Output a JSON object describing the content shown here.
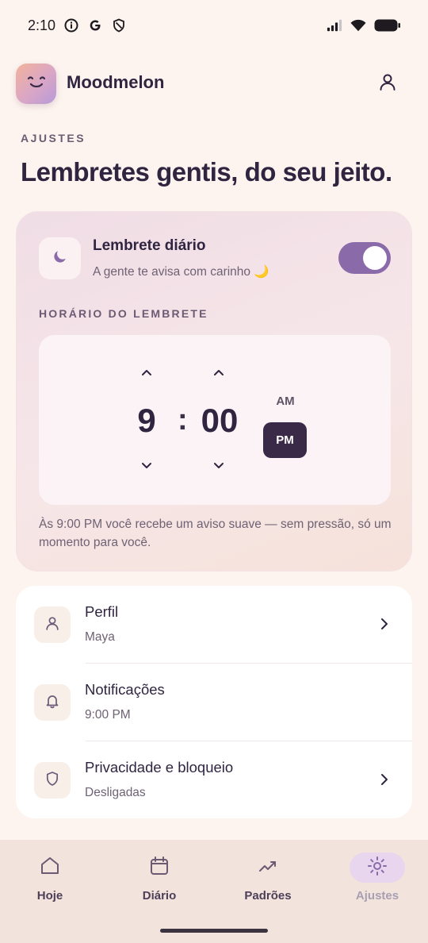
{
  "status_bar": {
    "time": "2:10",
    "left_icons": [
      "info-icon",
      "google-icon",
      "shield-icon"
    ],
    "right_icons": [
      "signal-icon",
      "wifi-icon",
      "battery-icon"
    ]
  },
  "header": {
    "app_name": "Moodmelon",
    "logo_icon": "smile-face-icon",
    "profile_icon": "user-icon"
  },
  "page": {
    "section_label": "AJUSTES",
    "title": "Lembretes gentis, do seu jeito."
  },
  "reminder": {
    "icon": "moon-icon",
    "title": "Lembrete diário",
    "subtitle": "A gente te avisa com carinho 🌙",
    "enabled": true,
    "time_label": "HORÁRIO DO LEMBRETE",
    "hour": "9",
    "separator": ":",
    "minute": "00",
    "am_label": "AM",
    "pm_label": "PM",
    "selected_period": "PM",
    "note": "Às 9:00 PM você recebe um aviso suave — sem pressão, só um momento para você."
  },
  "settings": [
    {
      "title": "Perfil",
      "subtitle": "Maya",
      "icon": "user-icon",
      "has_chevron": true
    },
    {
      "title": "Notificações",
      "subtitle": "9:00 PM",
      "icon": "bell-icon",
      "has_chevron": false
    },
    {
      "title": "Privacidade e bloqueio",
      "subtitle": "Desligadas",
      "icon": "shield-icon",
      "has_chevron": true
    }
  ],
  "nav": [
    {
      "label": "Hoje",
      "icon": "home-icon",
      "active": false
    },
    {
      "label": "Diário",
      "icon": "calendar-icon",
      "active": false
    },
    {
      "label": "Padrões",
      "icon": "trend-icon",
      "active": false
    },
    {
      "label": "Ajustes",
      "icon": "sun-icon",
      "active": true
    }
  ],
  "colors": {
    "accent": "#8a6aa8",
    "dark": "#3a2a48",
    "background": "#fdf4ef"
  }
}
